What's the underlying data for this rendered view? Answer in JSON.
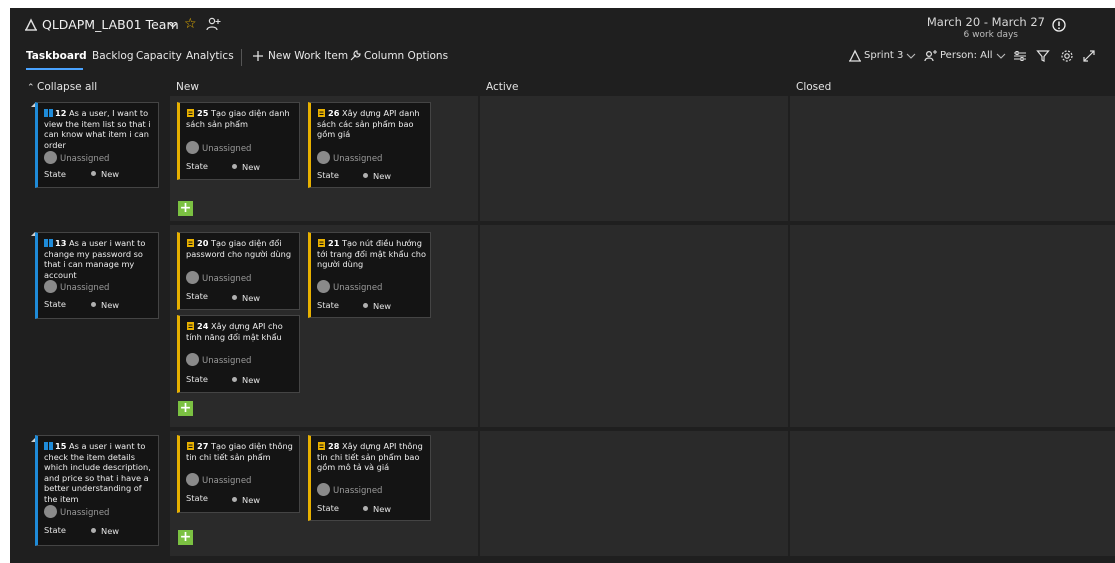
{
  "header": {
    "team_name": "QLDAPM_LAB01 Team",
    "date_range": "March 20 - March 27",
    "work_days": "6 work days"
  },
  "tabs": [
    "Taskboard",
    "Backlog",
    "Capacity",
    "Analytics"
  ],
  "toolbar": {
    "new_work_item": "New Work Item",
    "column_options": "Column Options",
    "sprint": "Sprint 3",
    "person_filter": "Person: All"
  },
  "board": {
    "collapse_all": "Collapse all",
    "columns": [
      "New",
      "Active",
      "Closed"
    ],
    "state_label": "State",
    "state_value": "New",
    "unassigned": "Unassigned",
    "lanes": [
      {
        "story": {
          "id": "12",
          "title": "As a user, I want to view the item list so that i can know what item i can order"
        },
        "tasks": [
          {
            "id": "25",
            "title": "Tạo giao diện danh sách sản phẩm"
          },
          {
            "id": "26",
            "title": "Xây dựng API danh sách các sản phẩm bao gồm giá"
          }
        ]
      },
      {
        "story": {
          "id": "13",
          "title": "As a user i want to change my password so that i can manage my account"
        },
        "tasks": [
          {
            "id": "20",
            "title": "Tạo giao diện đổi password cho người dùng"
          },
          {
            "id": "21",
            "title": "Tạo nút điều hướng tới trang đổi mật khẩu cho người dùng"
          },
          {
            "id": "24",
            "title": "Xây dựng API cho tính năng đổi mật khẩu"
          }
        ]
      },
      {
        "story": {
          "id": "15",
          "title": "As a user i want to check the item details which include description, and price so that i have a better understanding of the item"
        },
        "tasks": [
          {
            "id": "27",
            "title": "Tạo giao diện thông tin chi tiết sản phẩm"
          },
          {
            "id": "28",
            "title": "Xây dựng API thông tin chi tiết sản phẩm bao gồm mô tả và giá"
          }
        ]
      }
    ]
  },
  "colors": {
    "story_accent": "#1f8bd8",
    "task_accent": "#e8b100",
    "add_button": "#7bc142",
    "tab_underline": "#4aa3ff",
    "background": "#1f1f1f",
    "lane_background": "#2a2a2a"
  },
  "icons": {
    "team": "team-icon",
    "favorite": "star-icon",
    "follow": "people-icon",
    "info": "info-icon",
    "new_item": "plus-icon",
    "column_options": "wrench-icon",
    "sprint": "sprint-icon",
    "person": "person-icon",
    "settings": "sliders-icon",
    "filter": "filter-icon",
    "gear": "gear-icon",
    "fullscreen": "expand-icon",
    "story": "book-icon",
    "task": "clipboard-icon"
  }
}
